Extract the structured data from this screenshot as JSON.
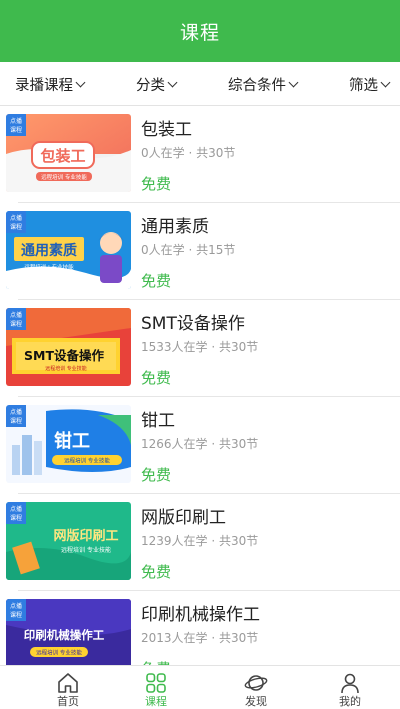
{
  "header": {
    "title": "课程"
  },
  "filters": [
    {
      "label": "录播课程"
    },
    {
      "label": "分类"
    },
    {
      "label": "综合条件"
    },
    {
      "label": "筛选"
    }
  ],
  "courses": [
    {
      "title": "包装工",
      "meta": "0人在学 · 共30节",
      "price": "免费",
      "thumb": {
        "badge": [
          "点播",
          "课程"
        ],
        "caption": "包装工",
        "sub": "远程培训  专业技能"
      }
    },
    {
      "title": "通用素质",
      "meta": "0人在学 · 共15节",
      "price": "免费",
      "thumb": {
        "badge": [
          "点播",
          "课程"
        ],
        "caption": "通用素质",
        "sub": "远程培训 | 专业技能"
      }
    },
    {
      "title": "SMT设备操作",
      "meta": "1533人在学 · 共30节",
      "price": "免费",
      "thumb": {
        "badge": [
          "点播",
          "课程"
        ],
        "caption": "SMT设备操作",
        "sub": "远程培训  专业技能"
      }
    },
    {
      "title": "钳工",
      "meta": "1266人在学 · 共30节",
      "price": "免费",
      "thumb": {
        "badge": [
          "点播",
          "课程"
        ],
        "caption": "钳工",
        "sub": "远程培训  专业技能"
      }
    },
    {
      "title": "网版印刷工",
      "meta": "1239人在学 · 共30节",
      "price": "免费",
      "thumb": {
        "badge": [
          "点播",
          "课程"
        ],
        "caption": "网版印刷工",
        "sub": "远程培训 专业技能"
      }
    },
    {
      "title": "印刷机械操作工",
      "meta": "2013人在学 · 共30节",
      "price": "免费",
      "thumb": {
        "badge": [
          "点播",
          "课程"
        ],
        "caption": "印刷机械操作工",
        "sub": "远程培训  专业技能"
      }
    }
  ],
  "tabbar": [
    {
      "label": "首页",
      "icon": "home-icon",
      "active": false
    },
    {
      "label": "课程",
      "icon": "course-icon",
      "active": true
    },
    {
      "label": "发现",
      "icon": "planet-icon",
      "active": false
    },
    {
      "label": "我的",
      "icon": "user-icon",
      "active": false
    }
  ],
  "colors": {
    "accent": "#3fba4d",
    "meta": "#9a9a9a"
  }
}
